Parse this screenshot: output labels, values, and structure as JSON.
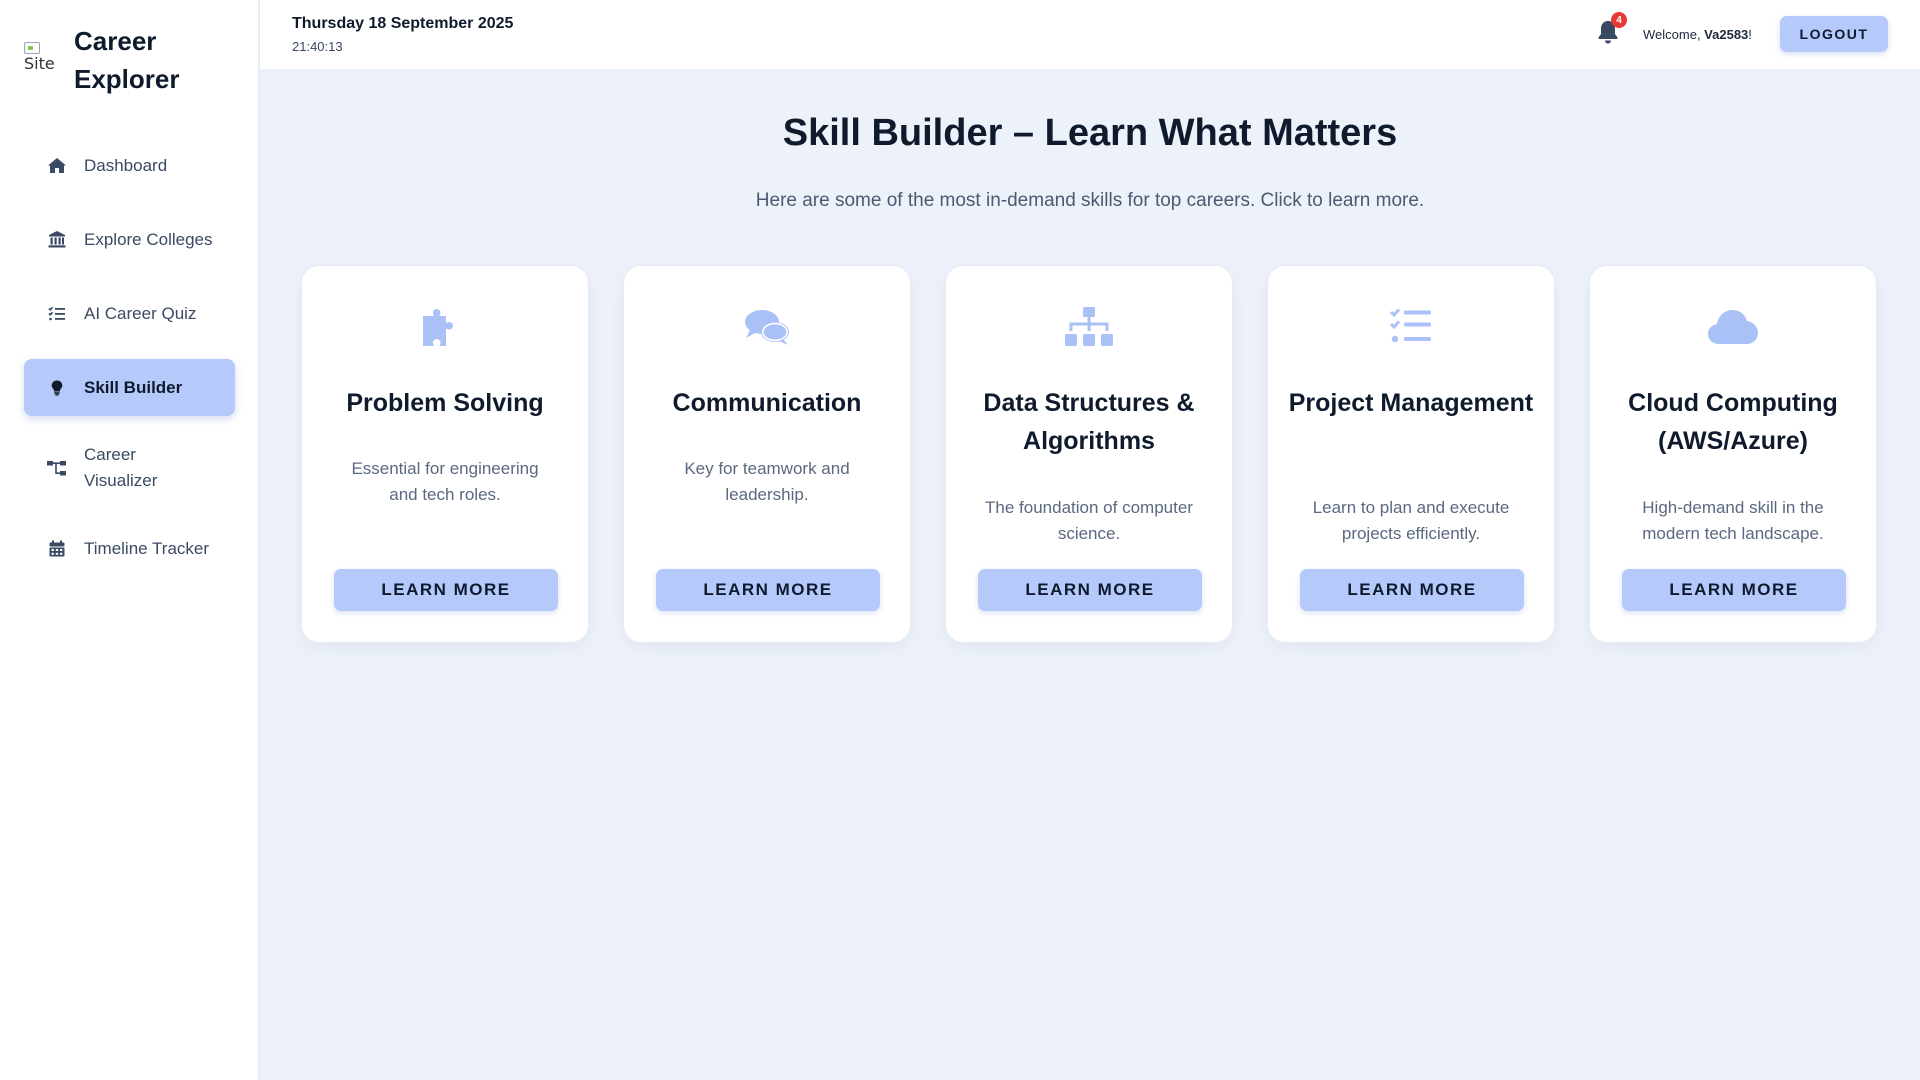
{
  "brand": {
    "logo_alt": "Site",
    "title": "Career\nExplorer"
  },
  "nav": [
    {
      "label": "Dashboard",
      "icon": "home-icon",
      "active": false
    },
    {
      "label": "Explore Colleges",
      "icon": "university-icon",
      "active": false
    },
    {
      "label": "AI Career Quiz",
      "icon": "list-check-icon",
      "active": false
    },
    {
      "label": "Skill Builder",
      "icon": "lightbulb-icon",
      "active": true
    },
    {
      "label": "Career\nVisualizer",
      "icon": "sitemap-icon",
      "active": false
    },
    {
      "label": "Timeline Tracker",
      "icon": "calendar-icon",
      "active": false
    }
  ],
  "header": {
    "date": "Thursday 18 September 2025",
    "time": "21:40:13",
    "notification_count": "4",
    "welcome_prefix": "Welcome, ",
    "username": "Va2583",
    "welcome_suffix": "!",
    "logout_label": "LOGOUT"
  },
  "main": {
    "title": "Skill Builder – Learn What Matters",
    "subtitle": "Here are some of the most in-demand skills for top careers. Click to learn more."
  },
  "skills": [
    {
      "icon": "puzzle-icon",
      "title": "Problem Solving",
      "description": "Essential for engineering and tech roles.",
      "button": "LEARN MORE"
    },
    {
      "icon": "comments-icon",
      "title": "Communication",
      "description": "Key for teamwork and leadership.",
      "button": "LEARN MORE"
    },
    {
      "icon": "sitemap-icon",
      "title": "Data Structures & Algorithms",
      "description": "The foundation of computer science.",
      "button": "LEARN MORE"
    },
    {
      "icon": "list-check-icon",
      "title": "Project Management",
      "description": "Learn to plan and execute projects efficiently.",
      "button": "LEARN MORE"
    },
    {
      "icon": "cloud-icon",
      "title": "Cloud Computing (AWS/Azure)",
      "description": "High-demand skill in the modern tech landscape.",
      "button": "LEARN MORE"
    }
  ],
  "colors": {
    "accent": "#b5c9fb",
    "icon_accent": "#a9c1f7",
    "background": "#edf2fa",
    "text_dark": "#0f1b2d",
    "badge": "#e53935"
  }
}
